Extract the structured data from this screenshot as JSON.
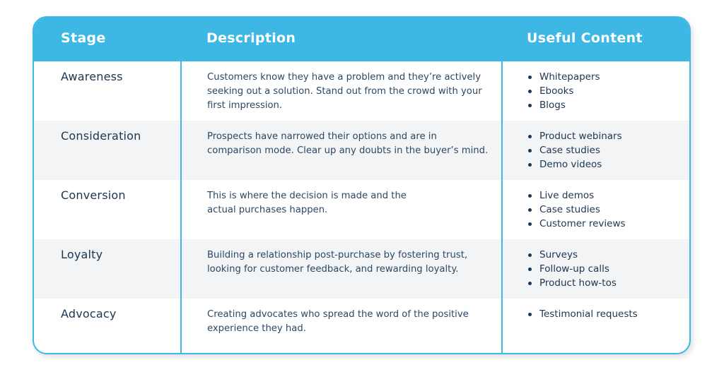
{
  "colors": {
    "accent": "#3db7e4",
    "text": "#1c3550",
    "row_alt": "#f2f4f5",
    "header_text": "#ffffff"
  },
  "table": {
    "headers": {
      "stage": "Stage",
      "description": "Description",
      "content": "Useful Content"
    },
    "rows": [
      {
        "stage": "Awareness",
        "description": "Customers know they have a problem and they’re actively seeking out a solution. Stand out from the crowd with your first impression.",
        "content": [
          "Whitepapers",
          "Ebooks",
          "Blogs"
        ]
      },
      {
        "stage": "Consideration",
        "description": "Prospects have narrowed their options and are in comparison mode. Clear up any doubts in the buyer’s mind.",
        "content": [
          "Product webinars",
          "Case studies",
          "Demo videos"
        ]
      },
      {
        "stage": "Conversion",
        "description": "This is where the decision is made and the actual purchases happen.",
        "content": [
          "Live demos",
          "Case studies",
          "Customer reviews"
        ]
      },
      {
        "stage": "Loyalty",
        "description": "Building a relationship post-purchase by fostering trust, looking for customer feedback, and rewarding loyalty.",
        "content": [
          "Surveys",
          "Follow-up calls",
          "Product how-tos"
        ]
      },
      {
        "stage": "Advocacy",
        "description": "Creating advocates who spread the word of the positive experience they had.",
        "content": [
          "Testimonial requests"
        ]
      }
    ]
  }
}
